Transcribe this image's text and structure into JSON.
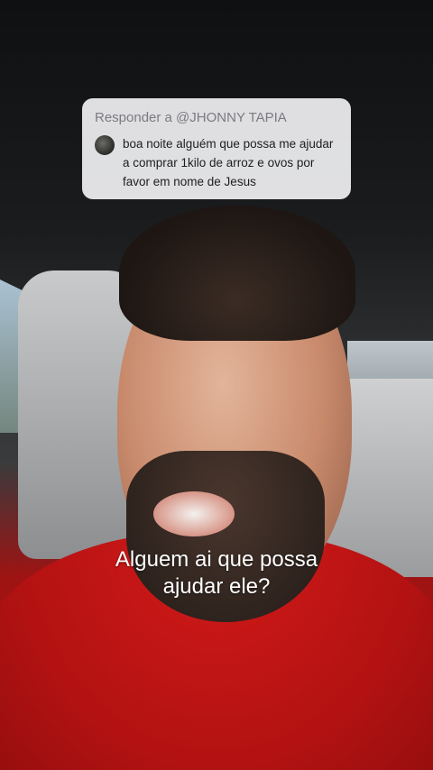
{
  "reply": {
    "header": "Responder a @JHONNY TAPIA",
    "comment": "boa noite alguém que possa me ajudar a comprar 1kilo de arroz e ovos por favor em nome de Jesus"
  },
  "caption": {
    "line1": "Alguem ai que possa",
    "line2": "ajudar ele?"
  },
  "colors": {
    "shirt": "#b81414",
    "card_background": "#e8e8ea",
    "caption_text": "#ffffff"
  }
}
